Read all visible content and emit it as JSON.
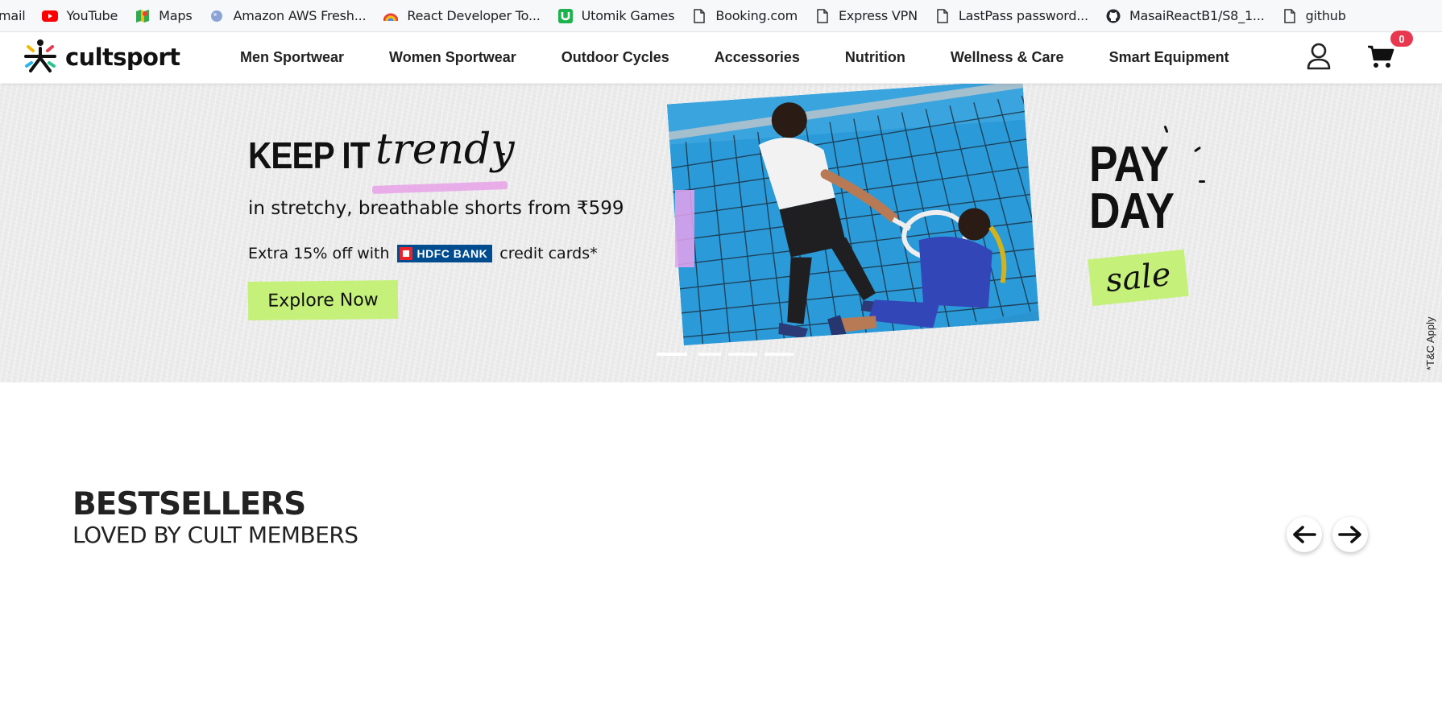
{
  "bookmarks": [
    {
      "label": "mail",
      "icon": "gmail-icon"
    },
    {
      "label": "YouTube",
      "icon": "youtube-icon"
    },
    {
      "label": "Maps",
      "icon": "maps-icon"
    },
    {
      "label": "Amazon AWS Fresh...",
      "icon": "globe-icon"
    },
    {
      "label": "React Developer To...",
      "icon": "rainbow-icon"
    },
    {
      "label": "Utomik Games",
      "icon": "utomik-icon"
    },
    {
      "label": "Booking.com",
      "icon": "page-icon"
    },
    {
      "label": "Express VPN",
      "icon": "page-icon"
    },
    {
      "label": "LastPass password...",
      "icon": "page-icon"
    },
    {
      "label": "MasaiReactB1/S8_1...",
      "icon": "github-icon"
    },
    {
      "label": "github",
      "icon": "page-icon"
    }
  ],
  "header": {
    "brand": "cultsport",
    "nav": [
      "Men Sportwear",
      "Women Sportwear",
      "Outdoor Cycles",
      "Accessories",
      "Nutrition",
      "Wellness & Care",
      "Smart Equipment"
    ],
    "cart_count": "0"
  },
  "hero": {
    "headline": "KEEP IT",
    "headline_script": "trendy",
    "subline": "in stretchy, breathable shorts from ₹599",
    "offer_prefix": "Extra 15% off with",
    "bank_name": "HDFC BANK",
    "offer_suffix": "credit cards*",
    "cta": "Explore Now",
    "promo_line1": "PAY",
    "promo_line2": "DAY",
    "promo_tag": "sale",
    "terms": "*T&C Apply",
    "slide_count": 4,
    "active_slide": 1,
    "accent_green": "#c5f07a",
    "accent_pink": "#e8a6e8"
  },
  "bestsellers": {
    "title": "BESTSELLERS",
    "subtitle": "LOVED BY CULT MEMBERS"
  }
}
